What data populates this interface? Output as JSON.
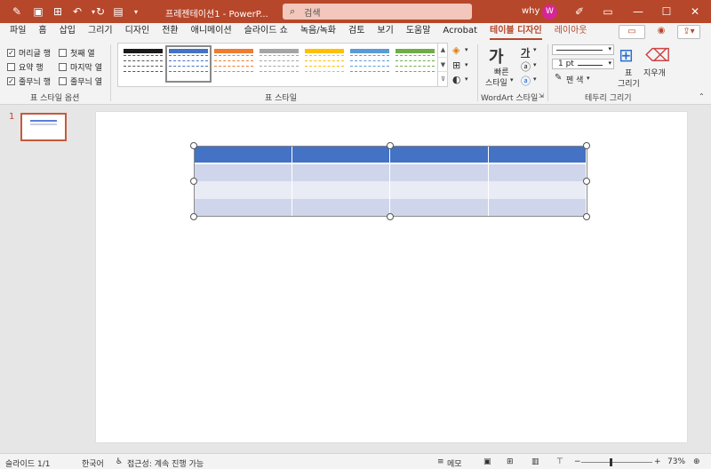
{
  "title_bar": {
    "doc_title": "프레젠테이션1  -  PowerP...",
    "search_placeholder": "검색",
    "user_name": "why",
    "avatar_initial": "W",
    "accent": "#b7472a"
  },
  "tabs": [
    "파일",
    "홈",
    "삽입",
    "그리기",
    "디자인",
    "전환",
    "애니메이션",
    "슬라이드 쇼",
    "녹음/녹화",
    "검토",
    "보기",
    "도움말",
    "Acrobat",
    "테이블 디자인",
    "레이아웃"
  ],
  "active_tab": "테이블 디자인",
  "table_style_options": {
    "label": "표 스타일 옵션",
    "items": [
      {
        "label": "머리글 행",
        "checked": true
      },
      {
        "label": "첫째 열",
        "checked": false
      },
      {
        "label": "요약 행",
        "checked": false
      },
      {
        "label": "마지막 열",
        "checked": false
      },
      {
        "label": "줄무늬 행",
        "checked": true
      },
      {
        "label": "줄무늬 열",
        "checked": false
      }
    ]
  },
  "table_styles": {
    "label": "표 스타일",
    "thumb_colors": [
      "#1a1a1a",
      "#4472c4",
      "#ed7d31",
      "#a5a5a5",
      "#ffc000",
      "#5b9bd5",
      "#70ad47"
    ]
  },
  "wordart": {
    "label": "WordArt 스타일",
    "quick_styles": "빠른\n스타일",
    "quick_styles_l1": "빠른",
    "quick_styles_l2": "스타일",
    "glyph": "가"
  },
  "borders": {
    "label": "테두리 그리기",
    "weight": "1 pt",
    "pen_color": "펜 색",
    "draw_table": "표\n그리기",
    "draw_l1": "표",
    "draw_l2": "그리기",
    "eraser": "지우개"
  },
  "slides": [
    {
      "number": "1"
    }
  ],
  "table": {
    "rows": 4,
    "cols": 4,
    "header_color": "#4472c4",
    "band_colors": [
      "#cfd5ea",
      "#e9ebf5"
    ]
  },
  "status": {
    "slide_info": "슬라이드 1/1",
    "language": "한국어",
    "accessibility": "접근성: 계속 진행 가능",
    "notes": "메모",
    "zoom": "73%"
  }
}
